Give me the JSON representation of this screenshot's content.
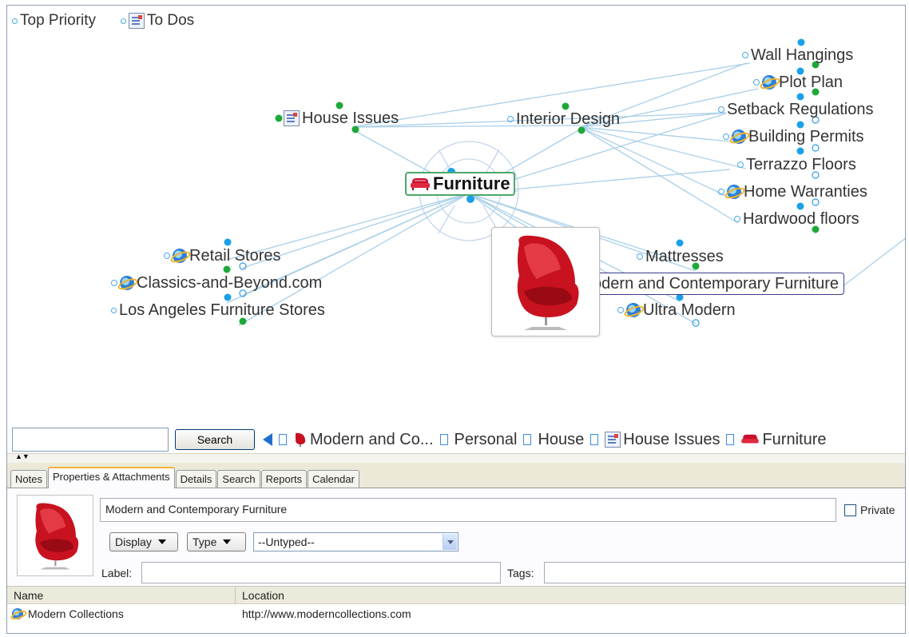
{
  "map": {
    "top_left": {
      "top_priority": "Top Priority",
      "to_dos": "To Dos"
    },
    "center": "Furniture",
    "nodes": {
      "house_issues": "House Issues",
      "interior_design": "Interior Design",
      "wall_hangings": "Wall Hangings",
      "plot_plan": "Plot Plan",
      "setback_regulations": "Setback Regulations",
      "building_permits": "Building Permits",
      "terrazzo_floors": "Terrazzo Floors",
      "home_warranties": "Home Warranties",
      "hardwood_floors": "Hardwood floors",
      "retail_stores": "Retail Stores",
      "classics_and_beyond": "Classics-and-Beyond.com",
      "los_angeles": "Los Angeles Furniture Stores",
      "mattresses": "Mattresses",
      "modern_contemporary": "Modern and Contemporary Furniture",
      "ultra_modern": "Ultra Modern"
    },
    "colors": {
      "link": "#a9cfe8",
      "dot_blue": "#1aa0e8",
      "dot_green": "#1fa83a",
      "center_border": "#4aa86a",
      "selected_border": "#3b3b8e"
    }
  },
  "search": {
    "input_value": "",
    "button_label": "Search"
  },
  "breadcrumbs": [
    {
      "label": "Modern and Co...",
      "icon": "chair-icon"
    },
    {
      "label": "Personal",
      "icon": ""
    },
    {
      "label": "House",
      "icon": ""
    },
    {
      "label": "House Issues",
      "icon": "document-icon"
    },
    {
      "label": "Furniture",
      "icon": "sofa-icon"
    }
  ],
  "tabs": [
    {
      "label": "Notes",
      "active": false
    },
    {
      "label": "Properties & Attachments",
      "active": true
    },
    {
      "label": "Details",
      "active": false
    },
    {
      "label": "Search",
      "active": false
    },
    {
      "label": "Reports",
      "active": false
    },
    {
      "label": "Calendar",
      "active": false
    }
  ],
  "properties": {
    "title": "Modern and Contemporary Furniture",
    "private_label": "Private",
    "private_checked": false,
    "display_label": "Display",
    "type_label": "Type",
    "type_value": "--Untyped--",
    "label_caption": "Label:",
    "label_value": "",
    "tags_caption": "Tags:",
    "tags_value": ""
  },
  "attachments": {
    "columns": [
      "Name",
      "Location"
    ],
    "rows": [
      {
        "name": "Modern Collections",
        "location": "http://www.moderncollections.com",
        "icon": "ie-icon"
      }
    ]
  }
}
